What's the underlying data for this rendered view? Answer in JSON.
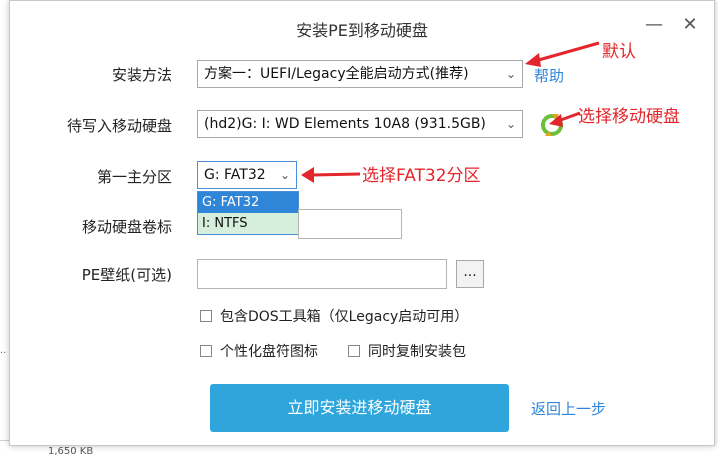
{
  "dialog": {
    "title": "安装PE到移动硬盘",
    "controls": {
      "minimize": "—",
      "close": "✕"
    }
  },
  "form": {
    "install_method": {
      "label": "安装方法",
      "value": "方案一：UEFI/Legacy全能启动方式(推荐)"
    },
    "help_link": "帮助",
    "target_disk": {
      "label": "待写入移动硬盘",
      "value": "(hd2)G: I: WD Elements 10A8 (931.5GB)"
    },
    "primary_partition": {
      "label": "第一主分区",
      "value": "G: FAT32",
      "options": [
        "G: FAT32",
        "I: NTFS"
      ]
    },
    "disk_label": {
      "label": "移动硬盘卷标",
      "value": ""
    },
    "wallpaper": {
      "label": "PE壁纸(可选)",
      "value": "",
      "browse": "..."
    },
    "options": {
      "dos_tools": "包含DOS工具箱（仅Legacy启动可用）",
      "custom_icon": "个性化盘符图标",
      "copy_installer": "同时复制安装包"
    },
    "install_button": "立即安装进移动硬盘",
    "back_link": "返回上一步"
  },
  "annotations": {
    "default": "默认",
    "select_disk": "选择移动硬盘",
    "select_partition": "选择FAT32分区",
    "color": "#e3262b"
  },
  "background": {
    "size_text": "1,650 KB"
  }
}
